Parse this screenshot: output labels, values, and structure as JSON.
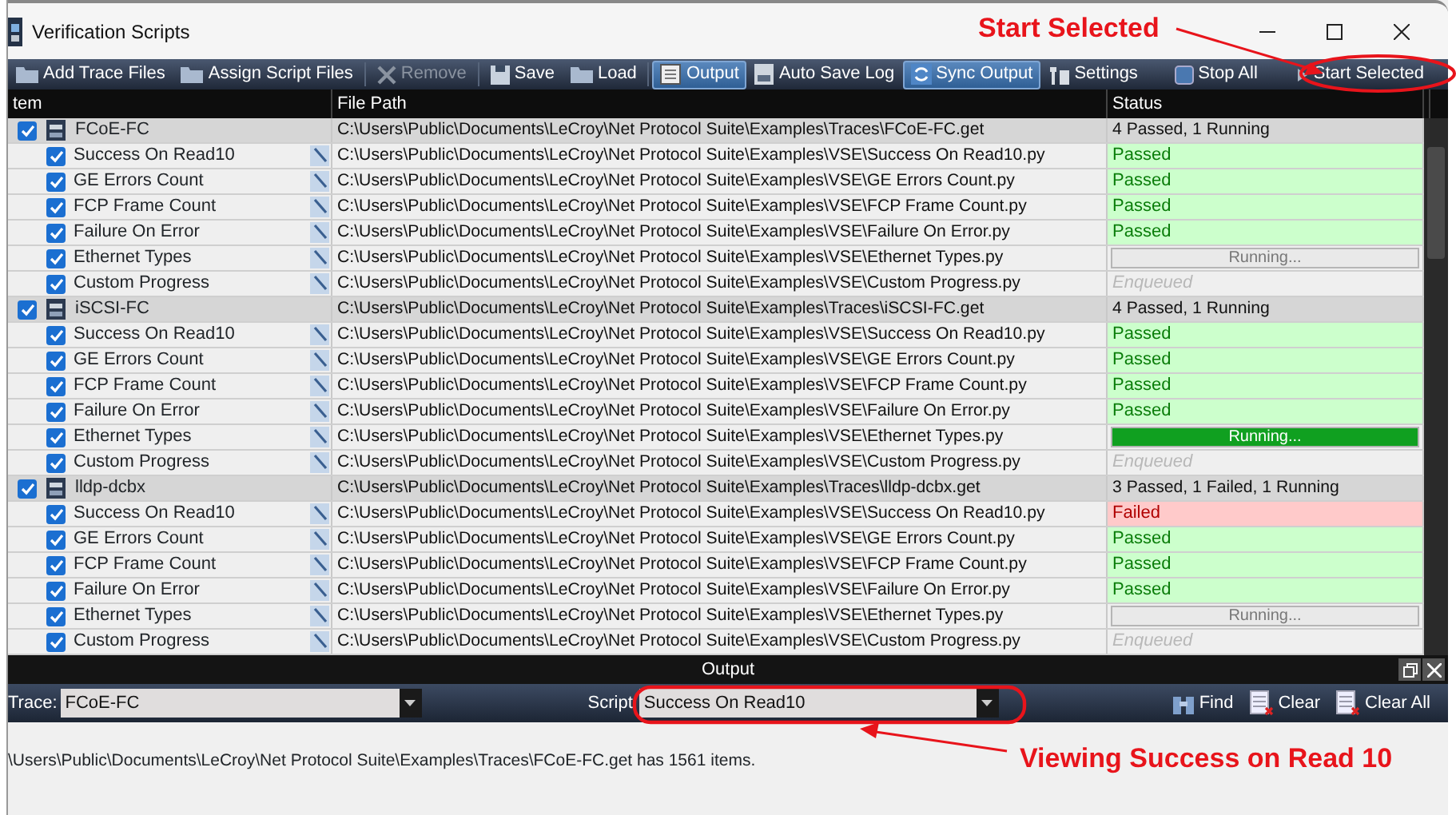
{
  "window": {
    "title": "Verification Scripts"
  },
  "toolbar": {
    "items": [
      {
        "label": "Add Trace Files",
        "selected": false,
        "disabled": false
      },
      {
        "label": "Assign Script Files",
        "selected": false,
        "disabled": false
      },
      {
        "label": "Remove",
        "selected": false,
        "disabled": true
      },
      {
        "label": "Save",
        "selected": false,
        "disabled": false
      },
      {
        "label": "Load",
        "selected": false,
        "disabled": false
      },
      {
        "label": "Output",
        "selected": true,
        "disabled": false
      },
      {
        "label": "Auto Save Log",
        "selected": false,
        "disabled": false
      },
      {
        "label": "Sync Output",
        "selected": true,
        "disabled": false
      },
      {
        "label": "Settings",
        "selected": false,
        "disabled": false
      }
    ],
    "right_items": [
      {
        "label": "Stop All"
      },
      {
        "label": "Start Selected"
      }
    ]
  },
  "table": {
    "columns": [
      "tem",
      "File Path",
      "Status"
    ],
    "rows": [
      {
        "name": "FCoE-FC",
        "checked": true,
        "path": "C:\\Users\\Public\\Documents\\LeCroy\\Net Protocol Suite\\Examples\\Traces\\FCoE-FC.get",
        "status": "4 Passed, 1 Running",
        "children": [
          {
            "name": "Success On Read10",
            "checked": true,
            "path": "C:\\Users\\Public\\Documents\\LeCroy\\Net Protocol Suite\\Examples\\VSE\\Success On Read10.py",
            "status": "Passed",
            "kind": "passed"
          },
          {
            "name": "GE Errors Count",
            "checked": true,
            "path": "C:\\Users\\Public\\Documents\\LeCroy\\Net Protocol Suite\\Examples\\VSE\\GE Errors Count.py",
            "status": "Passed",
            "kind": "passed"
          },
          {
            "name": "FCP Frame Count",
            "checked": true,
            "path": "C:\\Users\\Public\\Documents\\LeCroy\\Net Protocol Suite\\Examples\\VSE\\FCP Frame Count.py",
            "status": "Passed",
            "kind": "passed"
          },
          {
            "name": "Failure On Error",
            "checked": true,
            "path": "C:\\Users\\Public\\Documents\\LeCroy\\Net Protocol Suite\\Examples\\VSE\\Failure On Error.py",
            "status": "Passed",
            "kind": "passed"
          },
          {
            "name": "Ethernet Types",
            "checked": true,
            "path": "C:\\Users\\Public\\Documents\\LeCroy\\Net Protocol Suite\\Examples\\VSE\\Ethernet Types.py",
            "status": "Running...",
            "kind": "running",
            "level": 0
          },
          {
            "name": "Custom Progress",
            "checked": true,
            "path": "C:\\Users\\Public\\Documents\\LeCroy\\Net Protocol Suite\\Examples\\VSE\\Custom Progress.py",
            "status": "Enqueued",
            "kind": "enqueued"
          }
        ]
      },
      {
        "name": "iSCSI-FC",
        "checked": true,
        "path": "C:\\Users\\Public\\Documents\\LeCroy\\Net Protocol Suite\\Examples\\Traces\\iSCSI-FC.get",
        "status": "4 Passed, 1 Running",
        "children": [
          {
            "name": "Success On Read10",
            "checked": true,
            "path": "C:\\Users\\Public\\Documents\\LeCroy\\Net Protocol Suite\\Examples\\VSE\\Success On Read10.py",
            "status": "Passed",
            "kind": "passed"
          },
          {
            "name": "GE Errors Count",
            "checked": true,
            "path": "C:\\Users\\Public\\Documents\\LeCroy\\Net Protocol Suite\\Examples\\VSE\\GE Errors Count.py",
            "status": "Passed",
            "kind": "passed"
          },
          {
            "name": "FCP Frame Count",
            "checked": true,
            "path": "C:\\Users\\Public\\Documents\\LeCroy\\Net Protocol Suite\\Examples\\VSE\\FCP Frame Count.py",
            "status": "Passed",
            "kind": "passed"
          },
          {
            "name": "Failure On Error",
            "checked": true,
            "path": "C:\\Users\\Public\\Documents\\LeCroy\\Net Protocol Suite\\Examples\\VSE\\Failure On Error.py",
            "status": "Passed",
            "kind": "passed"
          },
          {
            "name": "Ethernet Types",
            "checked": true,
            "path": "C:\\Users\\Public\\Documents\\LeCroy\\Net Protocol Suite\\Examples\\VSE\\Ethernet Types.py",
            "status": "Running...",
            "kind": "running",
            "level": 1
          },
          {
            "name": "Custom Progress",
            "checked": true,
            "path": "C:\\Users\\Public\\Documents\\LeCroy\\Net Protocol Suite\\Examples\\VSE\\Custom Progress.py",
            "status": "Enqueued",
            "kind": "enqueued"
          }
        ]
      },
      {
        "name": "lldp-dcbx",
        "checked": true,
        "path": "C:\\Users\\Public\\Documents\\LeCroy\\Net Protocol Suite\\Examples\\Traces\\lldp-dcbx.get",
        "status": "3 Passed, 1 Failed, 1 Running",
        "children": [
          {
            "name": "Success On Read10",
            "checked": true,
            "path": "C:\\Users\\Public\\Documents\\LeCroy\\Net Protocol Suite\\Examples\\VSE\\Success On Read10.py",
            "status": "Failed",
            "kind": "failed"
          },
          {
            "name": "GE Errors Count",
            "checked": true,
            "path": "C:\\Users\\Public\\Documents\\LeCroy\\Net Protocol Suite\\Examples\\VSE\\GE Errors Count.py",
            "status": "Passed",
            "kind": "passed"
          },
          {
            "name": "FCP Frame Count",
            "checked": true,
            "path": "C:\\Users\\Public\\Documents\\LeCroy\\Net Protocol Suite\\Examples\\VSE\\FCP Frame Count.py",
            "status": "Passed",
            "kind": "passed"
          },
          {
            "name": "Failure On Error",
            "checked": true,
            "path": "C:\\Users\\Public\\Documents\\LeCroy\\Net Protocol Suite\\Examples\\VSE\\Failure On Error.py",
            "status": "Passed",
            "kind": "passed"
          },
          {
            "name": "Ethernet Types",
            "checked": true,
            "path": "C:\\Users\\Public\\Documents\\LeCroy\\Net Protocol Suite\\Examples\\VSE\\Ethernet Types.py",
            "status": "Running...",
            "kind": "running",
            "level": 0
          },
          {
            "name": "Custom Progress",
            "checked": true,
            "path": "C:\\Users\\Public\\Documents\\LeCroy\\Net Protocol Suite\\Examples\\VSE\\Custom Progress.py",
            "status": "Enqueued",
            "kind": "enqueued"
          }
        ]
      }
    ]
  },
  "output": {
    "title": "Output",
    "trace_label": "Trace:",
    "trace_value": "FCoE-FC",
    "script_label": "Script",
    "script_value": "Success On Read10",
    "actions": [
      {
        "label": "Find"
      },
      {
        "label": "Clear"
      },
      {
        "label": "Clear All"
      }
    ],
    "message": "\\Users\\Public\\Documents\\LeCroy\\Net Protocol Suite\\Examples\\Traces\\FCoE-FC.get has 1561 items."
  },
  "annotations": [
    {
      "text": "Start Selected"
    },
    {
      "text": "Viewing Success on Read 10"
    }
  ]
}
